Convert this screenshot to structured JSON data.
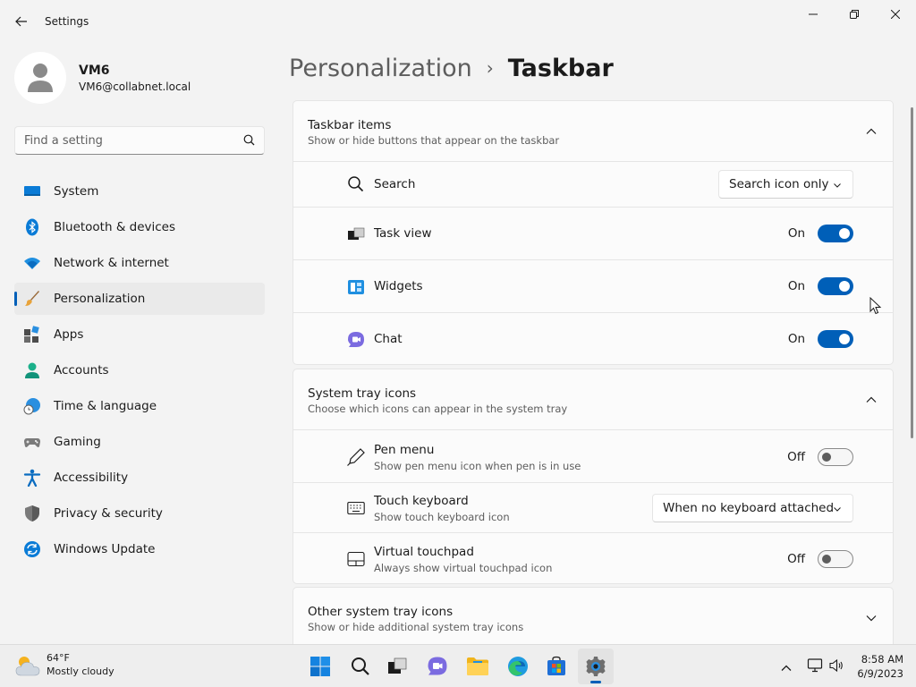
{
  "window": {
    "title": "Settings"
  },
  "profile": {
    "name": "VM6",
    "email": "VM6@collabnet.local"
  },
  "search": {
    "placeholder": "Find a setting"
  },
  "nav": {
    "items": [
      {
        "label": "System",
        "icon": "monitor-icon"
      },
      {
        "label": "Bluetooth & devices",
        "icon": "bluetooth-icon"
      },
      {
        "label": "Network & internet",
        "icon": "wifi-icon"
      },
      {
        "label": "Personalization",
        "icon": "brush-icon",
        "active": true
      },
      {
        "label": "Apps",
        "icon": "apps-icon"
      },
      {
        "label": "Accounts",
        "icon": "person-icon"
      },
      {
        "label": "Time & language",
        "icon": "globe-clock-icon"
      },
      {
        "label": "Gaming",
        "icon": "gamepad-icon"
      },
      {
        "label": "Accessibility",
        "icon": "accessibility-icon"
      },
      {
        "label": "Privacy & security",
        "icon": "shield-icon"
      },
      {
        "label": "Windows Update",
        "icon": "update-icon"
      }
    ]
  },
  "breadcrumb": {
    "parent": "Personalization",
    "separator": "›",
    "current": "Taskbar"
  },
  "taskbar_items": {
    "title": "Taskbar items",
    "subtitle": "Show or hide buttons that appear on the taskbar",
    "search": {
      "label": "Search",
      "value": "Search icon only"
    },
    "task_view": {
      "label": "Task view",
      "state": "On"
    },
    "widgets": {
      "label": "Widgets",
      "state": "On"
    },
    "chat": {
      "label": "Chat",
      "state": "On"
    }
  },
  "system_tray": {
    "title": "System tray icons",
    "subtitle": "Choose which icons can appear in the system tray",
    "pen_menu": {
      "label": "Pen menu",
      "sub": "Show pen menu icon when pen is in use",
      "state": "Off"
    },
    "touch_keyboard": {
      "label": "Touch keyboard",
      "sub": "Show touch keyboard icon",
      "value": "When no keyboard attached"
    },
    "virtual_touchpad": {
      "label": "Virtual touchpad",
      "sub": "Always show virtual touchpad icon",
      "state": "Off"
    }
  },
  "other_tray": {
    "title": "Other system tray icons",
    "subtitle": "Show or hide additional system tray icons"
  },
  "taskbar": {
    "weather_temp": "64°F",
    "weather_desc": "Mostly cloudy",
    "time": "8:58 AM",
    "date": "6/9/2023"
  },
  "colors": {
    "accent": "#005fb8",
    "background": "#f3f3f3",
    "card": "#fbfbfb"
  }
}
